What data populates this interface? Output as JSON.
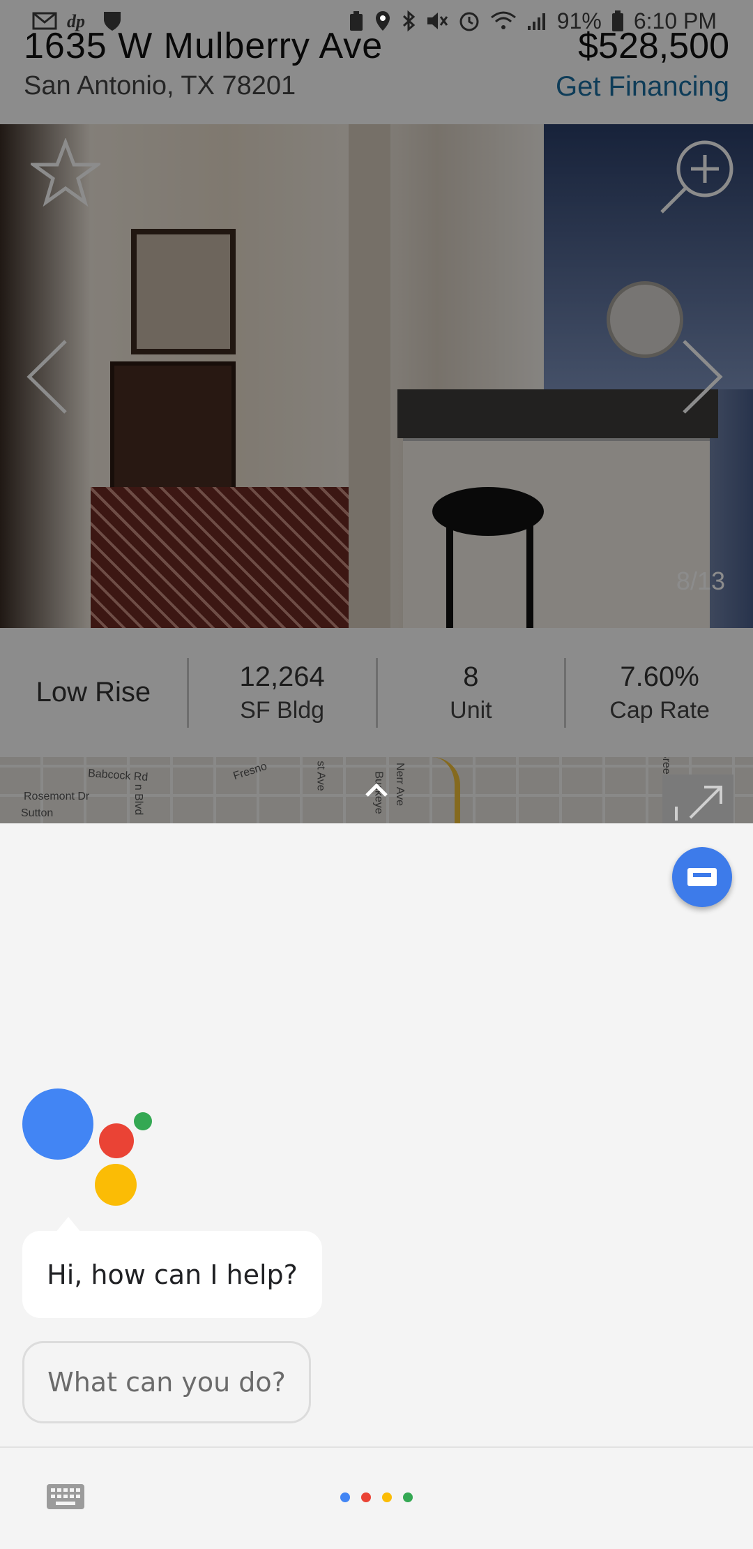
{
  "status_bar": {
    "battery": "91%",
    "time": "6:10 PM"
  },
  "listing": {
    "address": "1635 W Mulberry Ave",
    "city": "San Antonio, TX 78201",
    "price": "$528,500",
    "financing_link": "Get Financing",
    "photo_counter": "8/13"
  },
  "stats": [
    {
      "label": "Low Rise"
    },
    {
      "value": "12,264",
      "label": "SF Bldg"
    },
    {
      "value": "8",
      "label": "Unit"
    },
    {
      "value": "7.60%",
      "label": "Cap Rate"
    }
  ],
  "map": {
    "labels": [
      "Babcock Rd",
      "Fresno",
      "st Ave",
      "Rosemont Dr",
      "Sutton",
      "n Blvd",
      "Nerr Ave",
      "Buckeye",
      "Breeden St"
    ]
  },
  "assistant": {
    "greeting": "Hi, how can I help?",
    "suggestion_chip": "What can you do?",
    "colors": {
      "blue": "#4285f4",
      "red": "#ea4335",
      "yellow": "#fbbc05",
      "green": "#34a853",
      "fab": "#3d7bea"
    }
  },
  "icons": {
    "favorite": "star-icon",
    "zoom": "zoom-in-icon",
    "previous": "chevron-left-icon",
    "next": "chevron-right-icon",
    "map_expand": "expand-icon",
    "map_toggle": "chevron-up-icon",
    "keyboard": "keyboard-icon"
  }
}
